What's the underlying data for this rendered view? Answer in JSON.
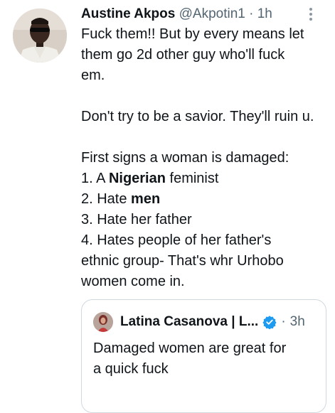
{
  "tweet": {
    "author_name": "Austine Akpos",
    "handle": "@Akpotin1",
    "separator": "·",
    "time": "1h",
    "more_icon": "more-vertical-icon",
    "lines": {
      "p1a": "Fuck them!! But by every means let",
      "p1b": "them go 2d other guy who'll fuck",
      "p1c": "em.",
      "p2": "Don't try to be a savior. They'll ruin u.",
      "p3": "First signs a woman is damaged:",
      "l1_pre": "1. A ",
      "l1_bold": "Nigerian",
      "l1_post": " feminist",
      "l2_pre": "2. Hate ",
      "l2_bold": "men",
      "l3": "3. Hate her father",
      "l4a": "4. Hates people of her father's",
      "l4b": "ethnic group- That's whr Urhobo",
      "l4c": "women come in."
    }
  },
  "quoted": {
    "author_name": "Latina Casanova | L...",
    "verified_icon": "verified-badge-icon",
    "separator": "·",
    "time": "3h",
    "text_line1": "Damaged women are great for",
    "text_line2": "a quick fuck"
  },
  "colors": {
    "text": "#0f1419",
    "secondary": "#536471",
    "verified": "#1d9bf0",
    "border": "#cfd9de"
  }
}
